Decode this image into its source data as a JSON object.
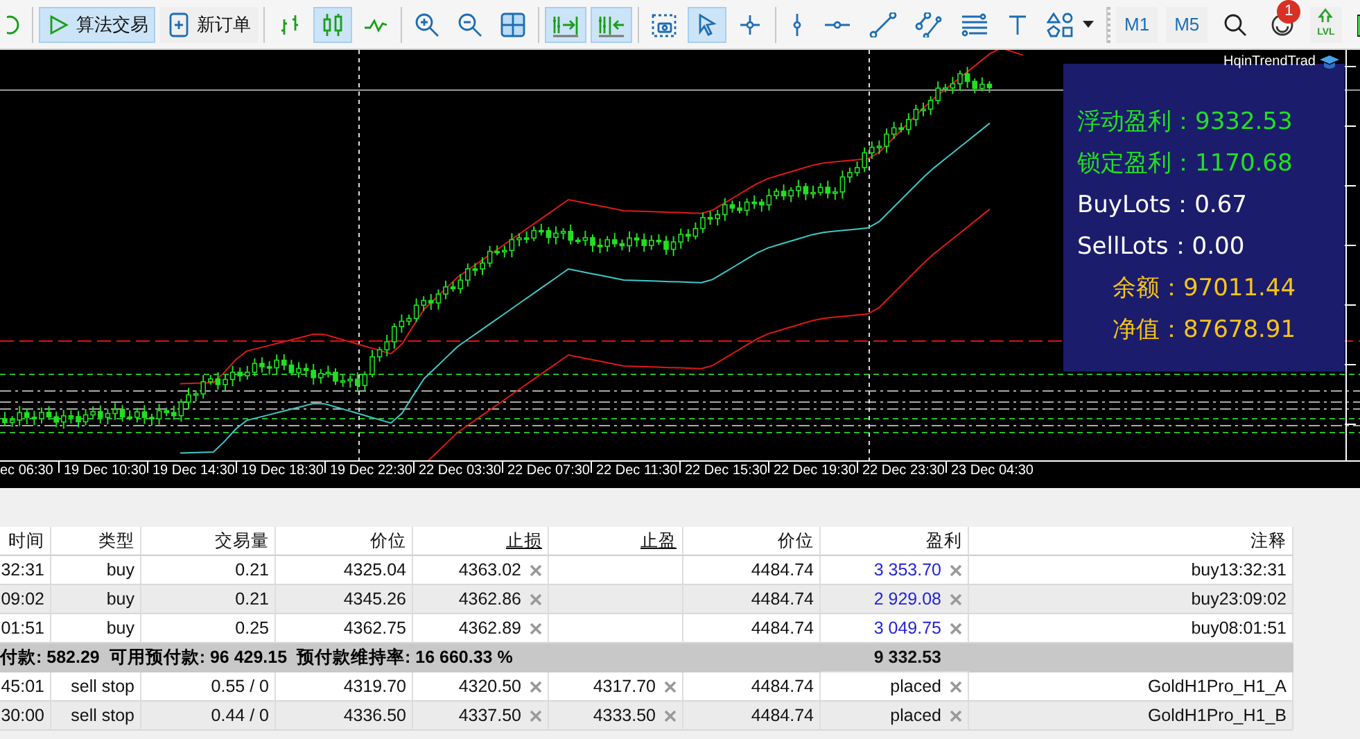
{
  "toolbar": {
    "groups": [
      [
        {
          "kind": "icon",
          "selected": false
        }
      ],
      [
        {
          "kind": "text",
          "label": "算法交易",
          "selected": true
        },
        {
          "kind": "text",
          "label": "新订单",
          "selected": false
        }
      ],
      [
        {
          "kind": "icon",
          "selected": false
        },
        {
          "kind": "icon",
          "selected": true
        },
        {
          "kind": "icon",
          "selected": false
        }
      ],
      [
        {
          "kind": "icon",
          "selected": false
        },
        {
          "kind": "icon",
          "selected": false
        },
        {
          "kind": "icon",
          "selected": false
        }
      ],
      [
        {
          "kind": "icon",
          "selected": true
        },
        {
          "kind": "icon",
          "selected": true
        }
      ],
      [
        {
          "kind": "icon",
          "selected": false
        },
        {
          "kind": "icon",
          "selected": true
        },
        {
          "kind": "icon",
          "selected": false
        }
      ],
      [
        {
          "kind": "icon",
          "selected": false
        },
        {
          "kind": "icon",
          "selected": false
        },
        {
          "kind": "icon",
          "selected": false
        },
        {
          "kind": "icon",
          "selected": false
        },
        {
          "kind": "icon",
          "selected": false
        },
        {
          "kind": "icon",
          "selected": false
        },
        {
          "kind": "dropdown",
          "selected": false
        }
      ],
      [
        {
          "kind": "timeframe",
          "label": "M1",
          "selected": false
        },
        {
          "kind": "timeframe",
          "label": "M5",
          "selected": false
        },
        {
          "kind": "icon",
          "selected": false
        },
        {
          "kind": "badge",
          "badge": "1",
          "selected": false
        },
        {
          "kind": "level",
          "label": "LVL",
          "selected": false
        },
        {
          "kind": "icon",
          "selected": false
        }
      ]
    ]
  },
  "chart": {
    "time_labels": [
      "ec 06:30",
      "19 Dec 10:30",
      "19 Dec 14:30",
      "19 Dec 18:30",
      "19 Dec 22:30",
      "22 Dec 03:30",
      "22 Dec 07:30",
      "22 Dec 11:30",
      "22 Dec 15:30",
      "22 Dec 19:30",
      "22 Dec 23:30",
      "23 Dec 04:30"
    ],
    "expert_name": "HqinTrendTrad",
    "info_panel": [
      {
        "text": "浮动盈利：9332.53",
        "color": "#22e022",
        "kind": "stat"
      },
      {
        "text": "锁定盈利：1170.68",
        "color": "#22e022",
        "kind": "stat"
      },
      {
        "text": "BuyLots：0.67",
        "color": "#ffffff",
        "kind": "stat"
      },
      {
        "text": "SellLots：0.00",
        "color": "#ffffff",
        "kind": "stat"
      },
      {
        "text": "余额：97011.44",
        "color": "#f5c518",
        "kind": "account"
      },
      {
        "text": "净值：87678.91",
        "color": "#f5c518",
        "kind": "account"
      }
    ]
  },
  "table": {
    "columns": [
      {
        "label": "时间",
        "underlined": false
      },
      {
        "label": "类型",
        "underlined": false
      },
      {
        "label": "交易量",
        "underlined": false
      },
      {
        "label": "价位",
        "underlined": false
      },
      {
        "label": "止损",
        "underlined": true
      },
      {
        "label": "止盈",
        "underlined": true
      },
      {
        "label": "价位",
        "underlined": false
      },
      {
        "label": "盈利",
        "underlined": false
      },
      {
        "label": "注释",
        "underlined": false
      }
    ],
    "positions": [
      {
        "time": ":32:31",
        "type": "buy",
        "volume": "0.21",
        "price": "4325.04",
        "sl": "4363.02",
        "current": "4484.74",
        "profit": "3 353.70",
        "comment": "buy13:32:31"
      },
      {
        "time": ":09:02",
        "type": "buy",
        "volume": "0.21",
        "price": "4345.26",
        "sl": "4362.86",
        "current": "4484.74",
        "profit": "2 929.08",
        "comment": "buy23:09:02"
      },
      {
        "time": ":01:51",
        "type": "buy",
        "volume": "0.25",
        "price": "4362.75",
        "sl": "4362.89",
        "current": "4484.74",
        "profit": "3 049.75",
        "comment": "buy08:01:51"
      }
    ],
    "summary": {
      "text": "付款: 582.29  可用预付款: 96 429.15  预付款维持率: 16 660.33 %",
      "total": "9 332.53"
    },
    "orders": [
      {
        "time": ":45:01",
        "type": "sell stop",
        "volume": "0.55 / 0",
        "price": "4319.70",
        "sl": "4320.50",
        "tp": "4317.70",
        "current": "4484.74",
        "profit": "placed",
        "comment": "GoldH1Pro_H1_A"
      },
      {
        "time": ":30:00",
        "type": "sell stop",
        "volume": "0.44 / 0",
        "price": "4336.50",
        "sl": "4337.50",
        "tp": "4333.50",
        "current": "4484.74",
        "profit": "placed",
        "comment": "GoldH1Pro_H1_B"
      }
    ]
  }
}
